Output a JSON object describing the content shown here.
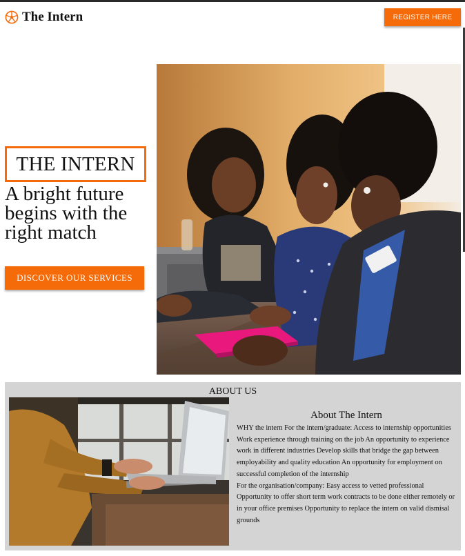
{
  "header": {
    "logo_text": "The Intern",
    "register_label": "REGISTER HERE",
    "logo_icon": "orange-wheel-icon"
  },
  "hero": {
    "badge": "THE INTERN",
    "headline": "A bright future begins with the right match",
    "cta_label": "DISCOVER OUR SERVICES"
  },
  "about": {
    "section_title": "ABOUT US",
    "heading": "About The Intern",
    "paragraph_1": "WHY the intern For the intern/graduate: Access to internship opportunities Work experience through training on the job An opportunity to experience work in different industries Develop skills that bridge the gap between employability and quality education An opportunity for employment on successful completion of the internship",
    "paragraph_2": "For the organisation/company: Easy access to vetted professional Opportunity to offer short term work contracts to be done either remotely or in your office premises Opportunity to replace the intern on valid dismisal grounds"
  },
  "colors": {
    "accent": "#f56b0a",
    "about_bg": "#d4d4d4",
    "text": "#111111"
  }
}
